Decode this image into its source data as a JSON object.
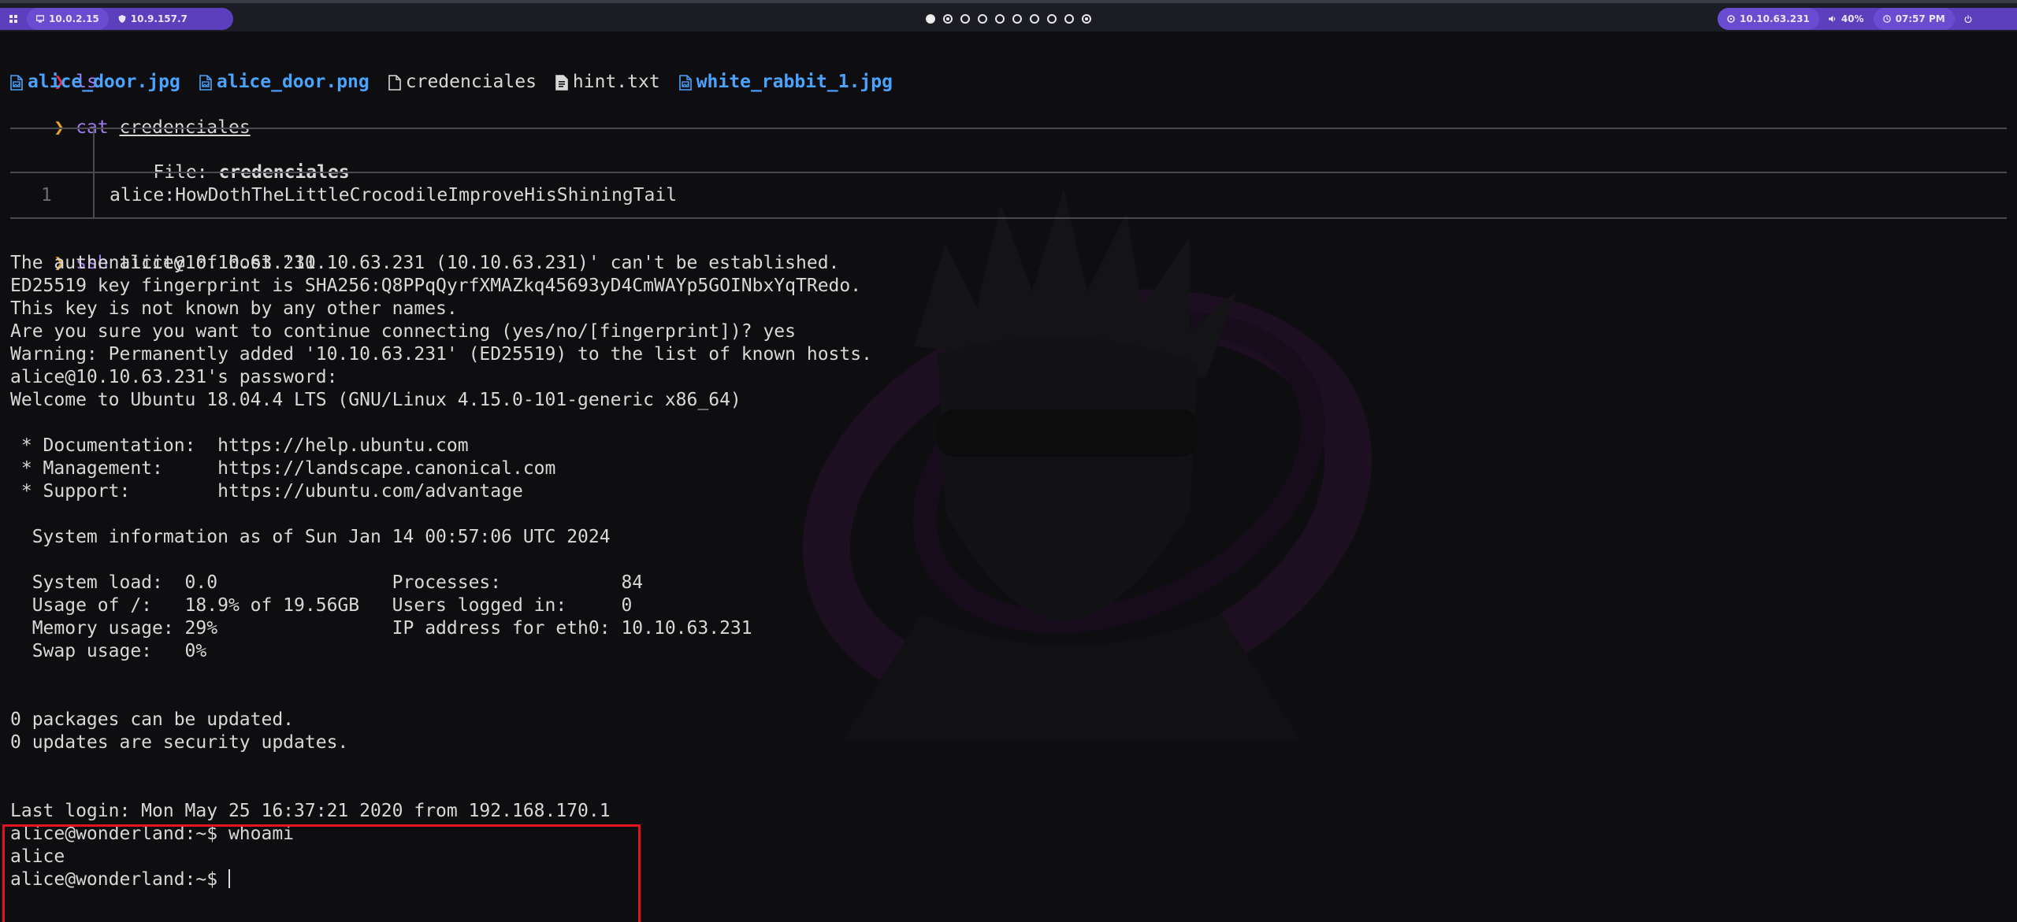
{
  "topbar": {
    "left_ip_1": "10.0.2.15",
    "left_ip_2": "10.9.157.7",
    "workspaces": [
      {
        "name": "ws-1",
        "state": "active"
      },
      {
        "name": "ws-2",
        "state": "target"
      },
      {
        "name": "ws-3",
        "state": "empty"
      },
      {
        "name": "ws-4",
        "state": "empty"
      },
      {
        "name": "ws-5",
        "state": "empty"
      },
      {
        "name": "ws-6",
        "state": "empty"
      },
      {
        "name": "ws-7",
        "state": "empty"
      },
      {
        "name": "ws-8",
        "state": "empty"
      },
      {
        "name": "ws-9",
        "state": "empty"
      },
      {
        "name": "ws-10",
        "state": "target"
      }
    ],
    "target_ip": "10.10.63.231",
    "volume": "40%",
    "clock": "07:57 PM",
    "accent_color": "#5b3fbd"
  },
  "terminal": {
    "prompt_symbol": "❯",
    "cmd_ls": "ls",
    "files": [
      {
        "name": "alice_door.jpg",
        "kind": "image"
      },
      {
        "name": "alice_door.png",
        "kind": "image"
      },
      {
        "name": "credenciales",
        "kind": "file"
      },
      {
        "name": "hint.txt",
        "kind": "text"
      },
      {
        "name": "white_rabbit_1.jpg",
        "kind": "image"
      }
    ],
    "cmd_cat": "cat",
    "cat_arg": "credenciales",
    "bat_file_label": "File: ",
    "bat_file_name": "credenciales",
    "bat_line_number": "1",
    "bat_line_content": "alice:HowDothTheLittleCrocodileImproveHisShiningTail",
    "cmd_ssh": "ssh",
    "ssh_arg": "alice@10.10.63.231",
    "output": [
      "The authenticity of host '10.10.63.231 (10.10.63.231)' can't be established.",
      "ED25519 key fingerprint is SHA256:Q8PPqQyrfXMAZkq45693yD4CmWAYp5GOINbxYqTRedo.",
      "This key is not known by any other names.",
      "Are you sure you want to continue connecting (yes/no/[fingerprint])? yes",
      "Warning: Permanently added '10.10.63.231' (ED25519) to the list of known hosts.",
      "alice@10.10.63.231's password: ",
      "Welcome to Ubuntu 18.04.4 LTS (GNU/Linux 4.15.0-101-generic x86_64)",
      "",
      " * Documentation:  https://help.ubuntu.com",
      " * Management:     https://landscape.canonical.com",
      " * Support:        https://ubuntu.com/advantage",
      "",
      "  System information as of Sun Jan 14 00:57:06 UTC 2024",
      "",
      "  System load:  0.0                Processes:           84",
      "  Usage of /:   18.9% of 19.56GB   Users logged in:     0",
      "  Memory usage: 29%                IP address for eth0: 10.10.63.231",
      "  Swap usage:   0%",
      "",
      "",
      "0 packages can be updated.",
      "0 updates are security updates.",
      "",
      "",
      "Last login: Mon May 25 16:37:21 2020 from 192.168.170.1",
      "alice@wonderland:~$ whoami",
      "alice",
      "alice@wonderland:~$ "
    ],
    "highlight_color": "#e3141e"
  }
}
